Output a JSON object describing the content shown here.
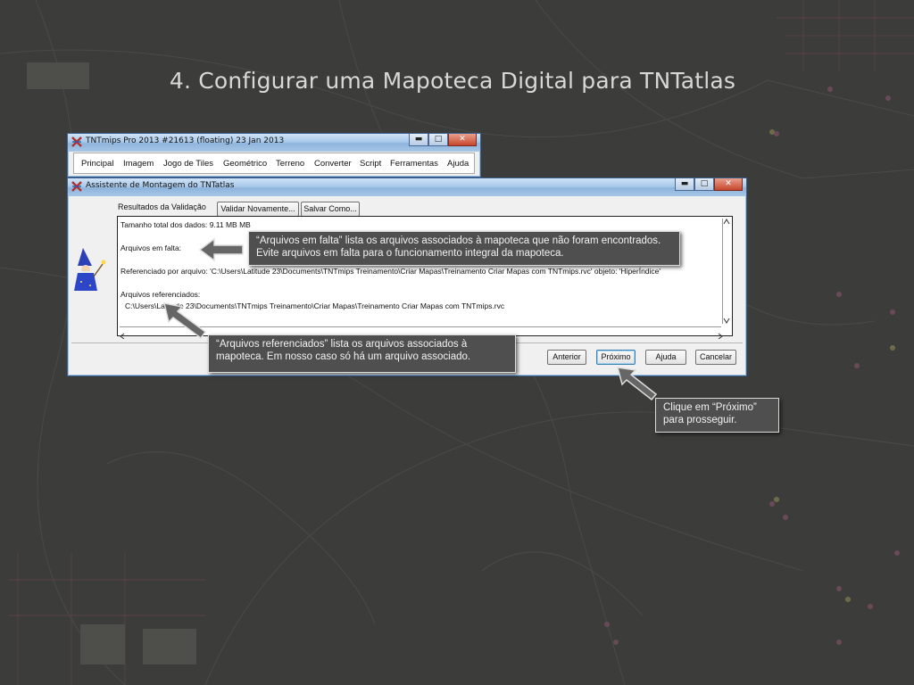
{
  "slide": {
    "title": "4. Configurar uma Mapoteca Digital para TNTatlas"
  },
  "main_window": {
    "title": "TNTmips Pro 2013    #21613 (floating)   23 Jan 2013",
    "controls": {
      "minimize": "▬",
      "maximize": "□",
      "close": "✕"
    },
    "menu": [
      "Principal",
      "Imagem",
      "Jogo de Tiles",
      "Geométrico",
      "Terreno",
      "Converter",
      "Script",
      "Ferramentas",
      "Ajuda"
    ]
  },
  "wizard": {
    "title": "Assistente de Montagem do TNTatlas",
    "controls": {
      "minimize": "▬",
      "maximize": "□",
      "close": "✕"
    },
    "validation_label": "Resultados da Validação",
    "validate_again": "Validar Novamente...",
    "save_as": "Salvar Como...",
    "report": {
      "size_line": "Tamanho total dos dados: 9.11 MB MB",
      "missing_label": "Arquivos em falta:",
      "referenced_by": "Referenciado por arquivo: 'C:\\Users\\Latitude 23\\Documents\\TNTmips Treinamento\\Criar Mapas\\Treinamento Criar Mapas com TNTmips.rvc' objeto: 'HiperÍndice'",
      "referenced_label": "Arquivos referenciados:",
      "referenced_file": "C:\\Users\\Latitude 23\\Documents\\TNTmips Treinamento\\Criar Mapas\\Treinamento Criar Mapas com TNTmips.rvc"
    },
    "buttons": {
      "previous": "Anterior",
      "next": "Próximo",
      "help": "Ajuda",
      "cancel": "Cancelar"
    }
  },
  "callouts": {
    "missing": "“Arquivos em falta” lista os arquivos associados à mapoteca que não foram encontrados. Evite arquivos em falta para o funcionamento integral da mapoteca.",
    "referenced": "“Arquivos referenciados” lista os arquivos associados à mapoteca. Em nosso caso só há um arquivo associado.",
    "next": "Clique em “Próximo” para prosseguir."
  },
  "colors": {
    "background": "#3a3a38",
    "callout": "#4f4f4f",
    "titlebar": "#a9c9ea"
  }
}
